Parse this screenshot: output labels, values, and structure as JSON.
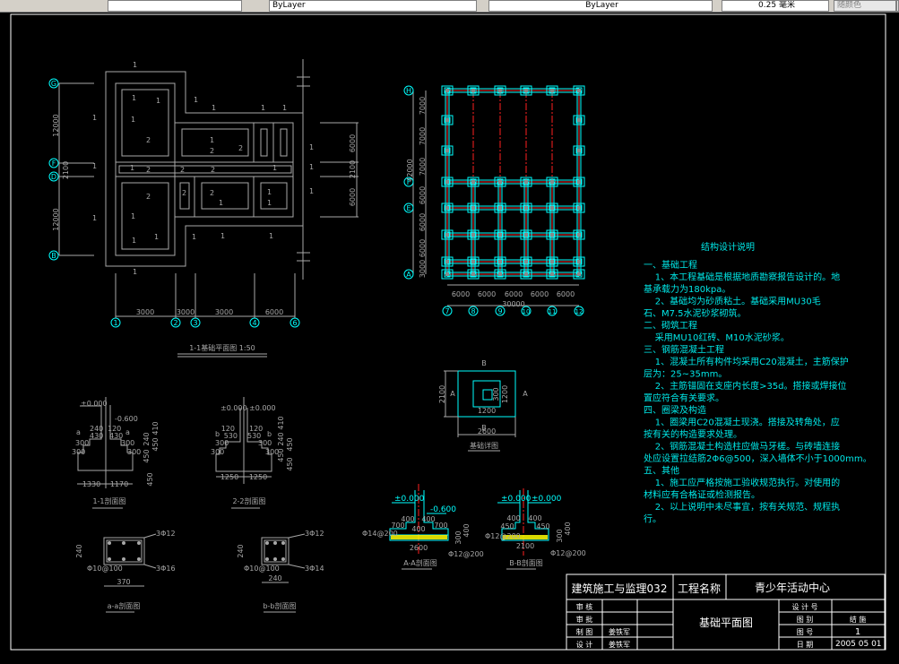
{
  "toolbar": {
    "layer_value": "ByLayer",
    "linetype_value": "ByLayer",
    "lineweight_value": "0.25 毫米",
    "plotstyle_value": "随颜色"
  },
  "plan_left": {
    "title": "1-1基础平面图 1:50",
    "axes_left": [
      "G",
      "F",
      "D",
      "B"
    ],
    "axes_bottom": [
      "1",
      "2",
      "3",
      "4",
      "6"
    ],
    "dims_bottom": [
      "3000",
      "3000",
      "3000",
      "6000"
    ],
    "dims_left": [
      "12000",
      "2100",
      "12000"
    ],
    "dims_right": [
      "6000",
      "2100",
      "6000"
    ],
    "section_mark_1": "1",
    "section_mark_2": "2"
  },
  "plan_right": {
    "axes_left": [
      "H",
      "F",
      "E",
      "A"
    ],
    "axes_bottom": [
      "7",
      "8",
      "9",
      "10",
      "11",
      "12"
    ],
    "dims_left": [
      "7000",
      "7000",
      "7000",
      "6000",
      "6000",
      "6000",
      "3000"
    ],
    "dim_total_left": "42000",
    "dims_bottom": [
      "6000",
      "6000",
      "6000",
      "6000",
      "6000"
    ],
    "dim_total_bottom": "30000"
  },
  "detail": {
    "title": "基础详图",
    "mark_a": "A",
    "mark_b": "B",
    "dim_2100": "2100",
    "dim_2600": "2600",
    "dim_1200": "1200",
    "dim_1200v": "1200",
    "dim_small": "300"
  },
  "sections": {
    "s11": {
      "title": "1-1剖面图",
      "elev_top": "±0.000",
      "elev": "-0.600",
      "d1": "240",
      "d2": "120",
      "d3": "430",
      "d4": "430",
      "d5": "300",
      "d6": "300",
      "d7": "300",
      "d8": "300",
      "w1": "1330",
      "w2": "1170",
      "h1": "410",
      "h2": "450",
      "h3": "240",
      "h4": "450",
      "h5": "450",
      "mark": "a"
    },
    "s22": {
      "title": "2-2剖面图",
      "elev_l": "±0.000",
      "elev_r": "±0.000",
      "d1": "120",
      "d2": "120",
      "d3": "530",
      "d4": "530",
      "d5": "300",
      "d6": "300",
      "d7": "300",
      "d8": "300",
      "w1": "1250",
      "w2": "1250",
      "h1": "410",
      "h2": "450",
      "h3": "240",
      "h4": "450",
      "h5": "450",
      "mark": "b"
    },
    "aa": {
      "title": "a-a剖面图",
      "top_bar": "3Φ12",
      "bottom_bar": "3Φ16",
      "stirrup": "Φ10@100",
      "height": "240",
      "width": "370"
    },
    "bb": {
      "title": "b-b剖面图",
      "top_bar": "3Φ12",
      "bottom_bar": "3Φ14",
      "stirrup": "Φ10@100",
      "height": "240",
      "width": "240"
    },
    "AA": {
      "title": "A-A剖面图",
      "elev": "±0.000",
      "elev2": "-0.600",
      "d400a": "400",
      "d400b": "400",
      "d400c": "400",
      "d700a": "700",
      "d700b": "700",
      "w": "2600",
      "h400": "400",
      "h300": "300",
      "rebar1": "Φ14@200",
      "rebar2": "Φ12@200"
    },
    "BB": {
      "title": "B-B剖面图",
      "elev_l": "±0.000",
      "elev_r": "±0.000",
      "d400a": "400",
      "d400b": "400",
      "d450a": "450",
      "d450b": "450",
      "w": "2100",
      "h400": "400",
      "h300": "300",
      "rebar1": "Φ12@200",
      "rebar2": "Φ12@200"
    }
  },
  "notes": {
    "title": "结构设计说明",
    "lines": [
      "一、基础工程",
      "    1、本工程基础是根据地质勘察报告设计的。地",
      "基承载力为180kpa。",
      "    2、基础均为砂质粘土。基础采用MU30毛",
      "石、M7.5水泥砂浆砌筑。",
      "二、砌筑工程",
      "    采用MU10红砖、M10水泥砂浆。",
      "三、钢筋混凝土工程",
      "    1、混凝土所有构件均采用C20混凝土，主筋保护",
      "层为：25~35mm。",
      "    2、主筋锚固在支座内长度>35d。搭接或焊接位",
      "置应符合有关要求。",
      "四、圈梁及构造",
      "    1、圈梁用C20混凝土现浇。搭接及转角处，应",
      "按有关的构造要求处理。",
      "    2、钢筋混凝土构造柱应做马牙槎。与砖墙连接",
      "处应设置拉结筋2Φ6@500，深入墙体不小于1000mm。",
      "五、其他",
      "    1、施工应严格按施工验收规范执行。对使用的",
      "材料应有合格证或检测报告。",
      "    2、以上说明中未尽事宜，按有关规范、规程执",
      "行。"
    ]
  },
  "title_block": {
    "company": "建筑施工与监理032",
    "project_label": "工程名称",
    "project_name": "青少年活动中心",
    "drawing_name": "基础平面图",
    "rows_left": [
      {
        "label": "审  核",
        "value": ""
      },
      {
        "label": "审  批",
        "value": ""
      },
      {
        "label": "制  图",
        "value": "姜铁军"
      },
      {
        "label": "设  计",
        "value": "姜铁军"
      }
    ],
    "rows_right": [
      {
        "label": "设 计 号",
        "value": ""
      },
      {
        "label": "图    别",
        "value": "结  施"
      },
      {
        "label": "图    号",
        "value": "1"
      },
      {
        "label": "日    期",
        "value": "2005 05 01"
      }
    ]
  }
}
